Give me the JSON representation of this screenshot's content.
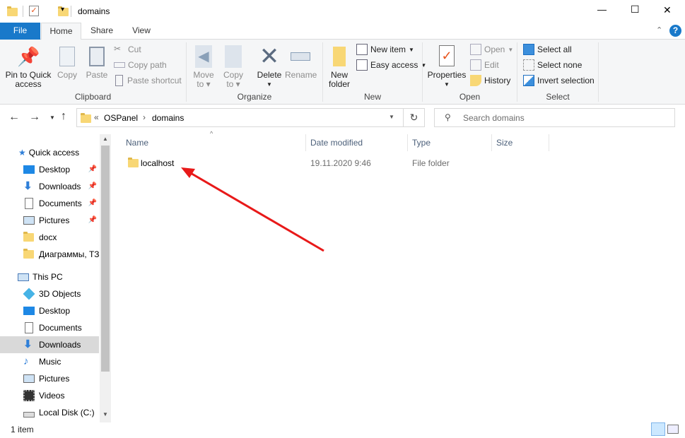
{
  "window": {
    "title": "domains",
    "minimize": "—",
    "maximize": "☐",
    "close": "✕"
  },
  "tabs": [
    {
      "label": "File"
    },
    {
      "label": "Home"
    },
    {
      "label": "Share"
    },
    {
      "label": "View"
    }
  ],
  "ribbon": {
    "clipboard": {
      "label": "Clipboard",
      "pin": "Pin to Quick",
      "pin2": "access",
      "copy": "Copy",
      "paste": "Paste",
      "cut": "Cut",
      "copy_path": "Copy path",
      "paste_shortcut": "Paste shortcut"
    },
    "organize": {
      "label": "Organize",
      "move": "Move",
      "move2": "to",
      "copy": "Copy",
      "copy2": "to",
      "delete": "Delete",
      "rename": "Rename"
    },
    "new": {
      "label": "New",
      "new_folder": "New",
      "new_folder2": "folder",
      "new_item": "New item",
      "easy_access": "Easy access"
    },
    "open": {
      "label": "Open",
      "properties": "Properties",
      "open": "Open",
      "edit": "Edit",
      "history": "History"
    },
    "select": {
      "label": "Select",
      "select_all": "Select all",
      "select_none": "Select none",
      "invert": "Invert selection"
    }
  },
  "address": {
    "prefix": "«",
    "crumbs": [
      "OSPanel",
      "domains"
    ],
    "search_placeholder": "Search domains"
  },
  "nav": {
    "quick_access": "Quick access",
    "quick": [
      {
        "label": "Desktop",
        "pinned": true
      },
      {
        "label": "Downloads",
        "pinned": true
      },
      {
        "label": "Documents",
        "pinned": true
      },
      {
        "label": "Pictures",
        "pinned": true
      },
      {
        "label": "docx"
      },
      {
        "label": "Диаграммы, ТЗ"
      }
    ],
    "this_pc": "This PC",
    "pc": [
      {
        "label": "3D Objects"
      },
      {
        "label": "Desktop"
      },
      {
        "label": "Documents"
      },
      {
        "label": "Downloads"
      },
      {
        "label": "Music"
      },
      {
        "label": "Pictures"
      },
      {
        "label": "Videos"
      },
      {
        "label": "Local Disk (C:)"
      }
    ]
  },
  "columns": {
    "name": "Name",
    "date": "Date modified",
    "type": "Type",
    "size": "Size"
  },
  "files": [
    {
      "name": "localhost",
      "date": "19.11.2020 9:46",
      "type": "File folder",
      "size": ""
    }
  ],
  "status": {
    "count": "1 item"
  },
  "colors": {
    "accent": "#1979ca",
    "arrow": "#e81919"
  }
}
